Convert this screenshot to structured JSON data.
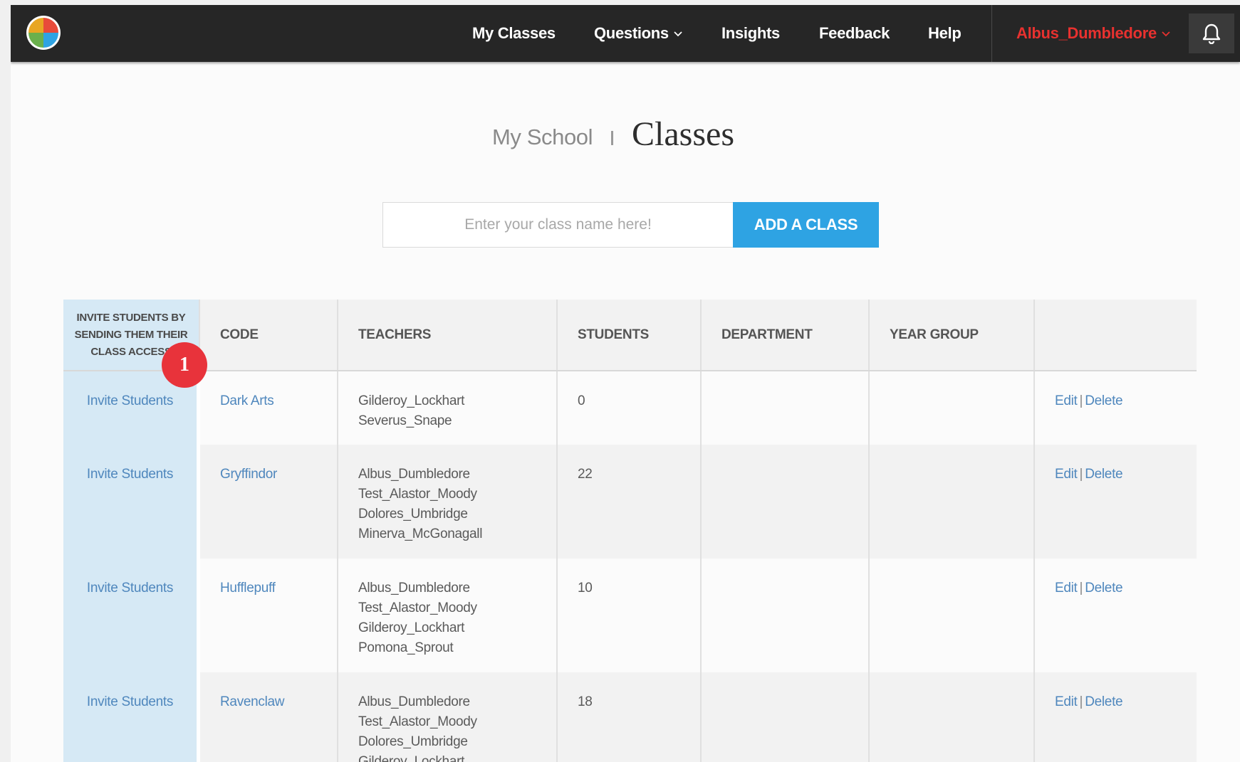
{
  "nav": {
    "items": [
      "My Classes",
      "Questions",
      "Insights",
      "Feedback",
      "Help"
    ],
    "user": "Albus_Dumbledore",
    "user_color": "#e8312f"
  },
  "heading": {
    "crumb": "My School",
    "title": "Classes"
  },
  "form": {
    "placeholder": "Enter your class name here!",
    "button": "ADD A CLASS",
    "button_color": "#2ea3e3"
  },
  "table": {
    "headers": {
      "invite": "INVITE STUDENTS BY SENDING THEM THEIR CLASS ACCESS",
      "code": "CODE",
      "teachers": "TEACHERS",
      "students": "STUDENTS",
      "department": "DEPARTMENT",
      "year_group": "YEAR GROUP"
    },
    "rows": [
      {
        "invite": "Invite Students",
        "code": "Dark Arts",
        "teachers": [
          "Gilderoy_Lockhart",
          "Severus_Snape"
        ],
        "students": "0",
        "department": "",
        "year_group": "",
        "edit": "Edit",
        "delete": "Delete"
      },
      {
        "invite": "Invite Students",
        "code": "Gryffindor",
        "teachers": [
          "Albus_Dumbledore",
          "Test_Alastor_Moody",
          "Dolores_Umbridge",
          "Minerva_McGonagall"
        ],
        "students": "22",
        "department": "",
        "year_group": "",
        "edit": "Edit",
        "delete": "Delete"
      },
      {
        "invite": "Invite Students",
        "code": "Hufflepuff",
        "teachers": [
          "Albus_Dumbledore",
          "Test_Alastor_Moody",
          "Gilderoy_Lockhart",
          "Pomona_Sprout"
        ],
        "students": "10",
        "department": "",
        "year_group": "",
        "edit": "Edit",
        "delete": "Delete"
      },
      {
        "invite": "Invite Students",
        "code": "Ravenclaw",
        "teachers": [
          "Albus_Dumbledore",
          "Test_Alastor_Moody",
          "Dolores_Umbridge",
          "Gilderoy_Lockhart"
        ],
        "students": "18",
        "department": "",
        "year_group": "",
        "edit": "Edit",
        "delete": "Delete"
      }
    ]
  },
  "annotation": {
    "badge": "1",
    "badge_color": "#e8333b"
  },
  "icons": [
    "app-logo-icon",
    "chevron-down-icon",
    "bell-icon"
  ]
}
